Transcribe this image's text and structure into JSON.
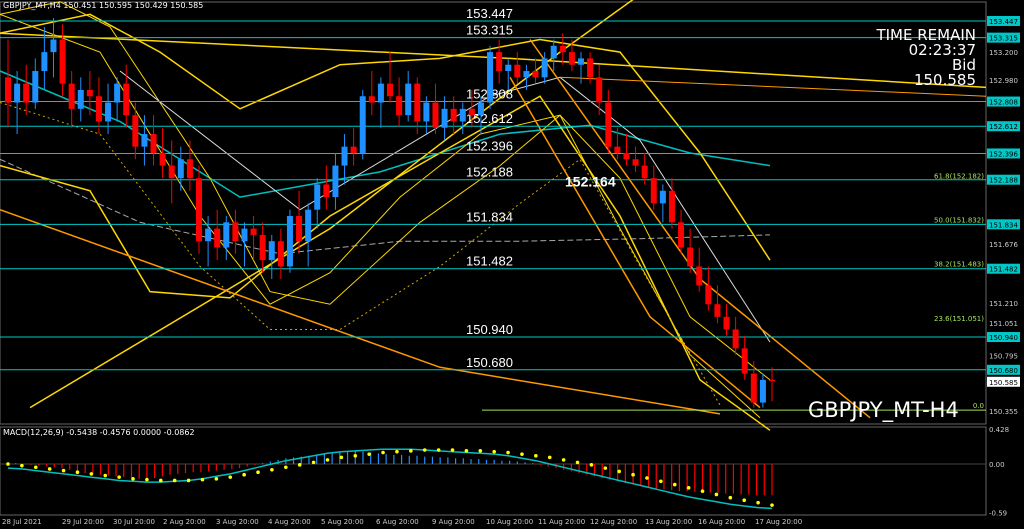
{
  "info": "GBPJPY_MT,H4  150.451 150.595 150.429 150.585",
  "symbol": "GBPJPY_MT-H4",
  "time_remain": {
    "label": "TIME REMAIN",
    "value": "02:23:37",
    "bid_label": "Bid",
    "bid_value": "150.585"
  },
  "macd_label": "MACD(12,26,9) -0.5438 -0.4576 0.0000 -0.0862",
  "colors": {
    "bull": "#1e90ff",
    "bear": "#ff0000",
    "level": "#00c8c8",
    "band": "#ffd800",
    "trend": "#ff9900",
    "ema": "#00bfbf",
    "macd_signal": "#ffff00"
  },
  "chart_data": {
    "type": "candlestick",
    "price_ylim": [
      150.25,
      153.55
    ],
    "price_ticks": [
      "153.447",
      "153.315",
      "153.200",
      "152.980",
      "152.808",
      "152.612",
      "152.396",
      "152.188",
      "151.834",
      "151.676",
      "151.482",
      "151.210",
      "151.051",
      "150.940",
      "150.795",
      "150.680",
      "150.585",
      "150.355"
    ],
    "levels": [
      {
        "value": 153.447,
        "label": "153.447"
      },
      {
        "value": 153.315,
        "label": "153.315"
      },
      {
        "value": 152.808,
        "label": "152.808"
      },
      {
        "value": 152.612,
        "label": "152.612"
      },
      {
        "value": 152.396,
        "label": "152.396"
      },
      {
        "value": 152.188,
        "label": "152.188"
      },
      {
        "value": 151.834,
        "label": "151.834"
      },
      {
        "value": 151.482,
        "label": "151.482"
      },
      {
        "value": 150.94,
        "label": "150.940"
      },
      {
        "value": 150.68,
        "label": "150.680"
      }
    ],
    "fib_labels": [
      {
        "value": 152.182,
        "label": "61.8(152.182)"
      },
      {
        "value": 151.832,
        "label": "50.0(151.832)"
      },
      {
        "value": 151.483,
        "label": "38.2(151.483)"
      },
      {
        "value": 151.051,
        "label": "23.6(151.051)"
      },
      {
        "value": 150.36,
        "label": "0.0"
      }
    ],
    "highlight_price": "152.164",
    "x_labels": [
      "28 Jul 2021",
      "29 Jul 20:00",
      "30 Jul 20:00",
      "2 Aug 20:00",
      "3 Aug 20:00",
      "4 Aug 20:00",
      "5 Aug 20:00",
      "6 Aug 20:00",
      "9 Aug 20:00",
      "10 Aug 20:00",
      "11 Aug 20:00",
      "12 Aug 20:00",
      "13 Aug 20:00",
      "16 Aug 20:00",
      "17 Aug 20:00"
    ],
    "macd_ticks": [
      "0.428",
      "0.00",
      "-0.59"
    ],
    "macd_ylim": [
      -0.62,
      0.45
    ],
    "macd_histogram": [
      0.02,
      0.01,
      0.0,
      -0.01,
      -0.02,
      -0.03,
      -0.04,
      -0.05,
      -0.07,
      -0.09,
      -0.11,
      -0.12,
      -0.13,
      -0.14,
      -0.15,
      -0.16,
      -0.17,
      -0.18,
      -0.18,
      -0.17,
      -0.15,
      -0.13,
      -0.12,
      -0.11,
      -0.1,
      -0.1,
      -0.09,
      -0.08,
      -0.07,
      -0.06,
      -0.05,
      -0.03,
      -0.01,
      0.01,
      0.03,
      0.05,
      0.07,
      0.08,
      0.09,
      0.1,
      0.11,
      0.12,
      0.13,
      0.14,
      0.15,
      0.16,
      0.15,
      0.14,
      0.13,
      0.12,
      0.11,
      0.11,
      0.1,
      0.1,
      0.09,
      0.09,
      0.08,
      0.08,
      0.07,
      0.07,
      0.06,
      0.06,
      0.05,
      0.05,
      0.04,
      0.04,
      0.03,
      0.02,
      0.01,
      -0.01,
      -0.03,
      -0.05,
      -0.07,
      -0.09,
      -0.11,
      -0.13,
      -0.15,
      -0.17,
      -0.19,
      -0.21,
      -0.23,
      -0.25,
      -0.27,
      -0.29,
      -0.3,
      -0.31,
      -0.32,
      -0.33,
      -0.33,
      -0.34,
      -0.34,
      -0.35,
      -0.35,
      -0.36,
      -0.36,
      -0.37,
      -0.37,
      -0.38,
      -0.38,
      -0.38
    ],
    "macd_main": [
      -0.05,
      -0.06,
      -0.08,
      -0.1,
      -0.12,
      -0.14,
      -0.16,
      -0.18,
      -0.2,
      -0.21,
      -0.22,
      -0.22,
      -0.21,
      -0.2,
      -0.18,
      -0.15,
      -0.12,
      -0.08,
      -0.04,
      0.0,
      0.04,
      0.07,
      0.1,
      0.13,
      0.15,
      0.16,
      0.17,
      0.18,
      0.18,
      0.18,
      0.17,
      0.16,
      0.15,
      0.14,
      0.13,
      0.12,
      0.1,
      0.07,
      0.04,
      0.0,
      -0.04,
      -0.08,
      -0.12,
      -0.16,
      -0.2,
      -0.24,
      -0.28,
      -0.32,
      -0.36,
      -0.4,
      -0.43,
      -0.46,
      -0.49,
      -0.51,
      -0.53,
      -0.54
    ],
    "macd_signal": [
      0.0,
      -0.02,
      -0.04,
      -0.06,
      -0.08,
      -0.1,
      -0.12,
      -0.14,
      -0.16,
      -0.18,
      -0.19,
      -0.2,
      -0.2,
      -0.2,
      -0.19,
      -0.18,
      -0.16,
      -0.13,
      -0.1,
      -0.07,
      -0.04,
      -0.01,
      0.02,
      0.05,
      0.08,
      0.1,
      0.12,
      0.14,
      0.15,
      0.16,
      0.17,
      0.17,
      0.17,
      0.16,
      0.16,
      0.15,
      0.14,
      0.12,
      0.1,
      0.08,
      0.05,
      0.02,
      -0.01,
      -0.05,
      -0.09,
      -0.13,
      -0.17,
      -0.21,
      -0.25,
      -0.29,
      -0.33,
      -0.37,
      -0.41,
      -0.44,
      -0.47,
      -0.5
    ],
    "candles": [
      [
        153.0,
        153.3,
        152.6,
        152.8
      ],
      [
        152.8,
        153.05,
        152.55,
        152.95
      ],
      [
        152.95,
        153.1,
        152.7,
        152.8
      ],
      [
        152.8,
        153.15,
        152.75,
        153.05
      ],
      [
        153.05,
        153.4,
        152.9,
        153.2
      ],
      [
        153.2,
        153.47,
        153.0,
        153.3
      ],
      [
        153.3,
        153.42,
        152.85,
        152.95
      ],
      [
        152.95,
        153.05,
        152.6,
        152.75
      ],
      [
        152.75,
        153.0,
        152.65,
        152.9
      ],
      [
        152.9,
        153.05,
        152.7,
        152.85
      ],
      [
        152.85,
        153.0,
        152.55,
        152.65
      ],
      [
        152.65,
        152.95,
        152.55,
        152.8
      ],
      [
        152.8,
        153.0,
        152.65,
        152.95
      ],
      [
        152.95,
        153.1,
        152.6,
        152.7
      ],
      [
        152.7,
        152.8,
        152.35,
        152.45
      ],
      [
        152.45,
        152.7,
        152.3,
        152.55
      ],
      [
        152.55,
        152.7,
        152.3,
        152.4
      ],
      [
        152.4,
        152.6,
        152.2,
        152.3
      ],
      [
        152.3,
        152.5,
        152.0,
        152.2
      ],
      [
        152.2,
        152.45,
        152.1,
        152.35
      ],
      [
        152.35,
        152.5,
        152.1,
        152.2
      ],
      [
        152.2,
        152.3,
        151.6,
        151.7
      ],
      [
        151.7,
        151.9,
        151.5,
        151.8
      ],
      [
        151.8,
        151.95,
        151.55,
        151.65
      ],
      [
        151.65,
        151.9,
        151.55,
        151.85
      ],
      [
        151.85,
        151.95,
        151.6,
        151.7
      ],
      [
        151.7,
        151.85,
        151.5,
        151.8
      ],
      [
        151.8,
        151.9,
        151.55,
        151.75
      ],
      [
        151.75,
        151.85,
        151.45,
        151.55
      ],
      [
        151.55,
        151.75,
        151.4,
        151.7
      ],
      [
        151.7,
        151.8,
        151.4,
        151.5
      ],
      [
        151.5,
        151.95,
        151.45,
        151.9
      ],
      [
        151.9,
        152.1,
        151.6,
        151.7
      ],
      [
        151.7,
        152.0,
        151.5,
        151.95
      ],
      [
        151.95,
        152.2,
        151.8,
        152.15
      ],
      [
        152.15,
        152.3,
        151.95,
        152.05
      ],
      [
        152.05,
        152.4,
        151.95,
        152.3
      ],
      [
        152.3,
        152.55,
        152.15,
        152.45
      ],
      [
        152.45,
        152.6,
        152.3,
        152.4
      ],
      [
        152.4,
        152.9,
        152.35,
        152.85
      ],
      [
        152.85,
        153.05,
        152.7,
        152.8
      ],
      [
        152.8,
        153.0,
        152.6,
        152.95
      ],
      [
        152.95,
        153.2,
        152.8,
        152.85
      ],
      [
        152.85,
        153.0,
        152.6,
        152.7
      ],
      [
        152.7,
        153.05,
        152.65,
        152.95
      ],
      [
        152.95,
        153.0,
        152.55,
        152.65
      ],
      [
        152.65,
        152.85,
        152.55,
        152.8
      ],
      [
        152.8,
        152.95,
        152.55,
        152.6
      ],
      [
        152.6,
        152.85,
        152.5,
        152.75
      ],
      [
        152.75,
        152.85,
        152.55,
        152.65
      ],
      [
        152.65,
        152.8,
        152.55,
        152.75
      ],
      [
        152.75,
        152.9,
        152.6,
        152.7
      ],
      [
        152.7,
        152.85,
        152.55,
        152.8
      ],
      [
        152.8,
        153.25,
        152.75,
        153.2
      ],
      [
        153.2,
        153.3,
        152.95,
        153.05
      ],
      [
        153.05,
        153.15,
        152.9,
        153.1
      ],
      [
        153.1,
        153.2,
        152.95,
        153.0
      ],
      [
        153.0,
        153.1,
        152.9,
        153.05
      ],
      [
        153.05,
        153.15,
        152.95,
        153.0
      ],
      [
        153.0,
        153.2,
        152.95,
        153.15
      ],
      [
        153.15,
        153.3,
        153.05,
        153.25
      ],
      [
        153.25,
        153.35,
        153.1,
        153.2
      ],
      [
        153.2,
        153.3,
        153.05,
        153.1
      ],
      [
        153.1,
        153.2,
        152.95,
        153.15
      ],
      [
        153.15,
        153.2,
        152.95,
        153.0
      ],
      [
        153.0,
        153.1,
        152.7,
        152.8
      ],
      [
        152.8,
        152.9,
        152.4,
        152.45
      ],
      [
        152.45,
        152.6,
        152.35,
        152.4
      ],
      [
        152.4,
        152.55,
        152.3,
        152.35
      ],
      [
        152.35,
        152.45,
        152.25,
        152.3
      ],
      [
        152.3,
        152.4,
        152.15,
        152.2
      ],
      [
        152.2,
        152.3,
        151.95,
        152.0
      ],
      [
        152.0,
        152.15,
        151.85,
        152.1
      ],
      [
        152.1,
        152.2,
        151.8,
        151.85
      ],
      [
        151.85,
        151.95,
        151.6,
        151.65
      ],
      [
        151.65,
        151.8,
        151.45,
        151.5
      ],
      [
        151.5,
        151.65,
        151.3,
        151.35
      ],
      [
        151.35,
        151.5,
        151.15,
        151.2
      ],
      [
        151.2,
        151.35,
        151.05,
        151.1
      ],
      [
        151.1,
        151.2,
        150.95,
        151.0
      ],
      [
        151.0,
        151.1,
        150.8,
        150.85
      ],
      [
        150.85,
        150.95,
        150.6,
        150.65
      ],
      [
        150.65,
        150.75,
        150.38,
        150.42
      ],
      [
        150.42,
        150.65,
        150.38,
        150.6
      ],
      [
        150.6,
        150.7,
        150.43,
        150.59
      ]
    ]
  }
}
